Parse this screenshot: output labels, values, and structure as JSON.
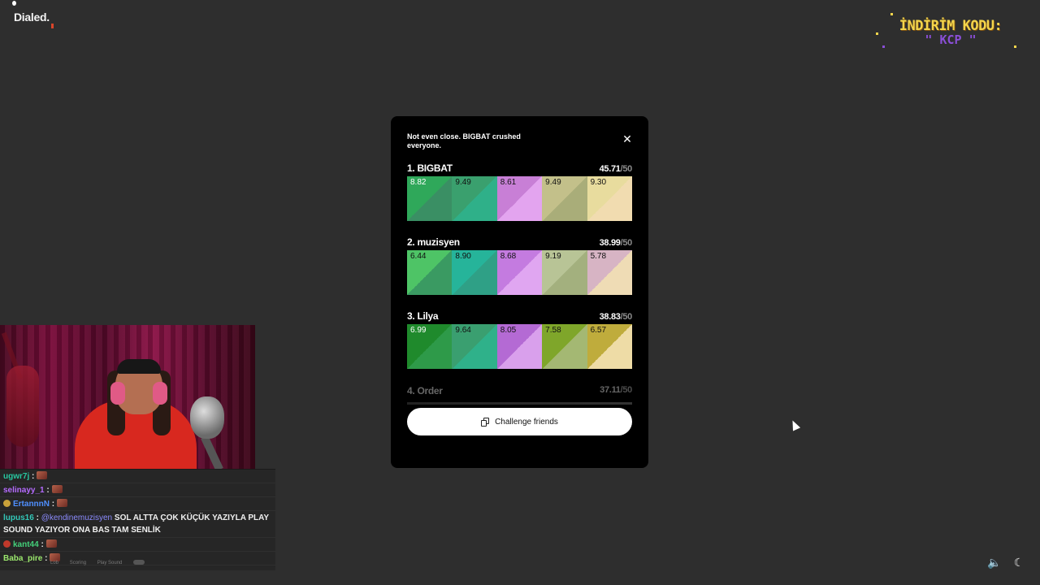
{
  "app": {
    "logo": "Dialed."
  },
  "promo": {
    "line1": "İNDİRİM KODU:",
    "line2": "\" KCP \""
  },
  "modal": {
    "message": "Not even close. BIGBAT crushed everyone.",
    "close_icon": "close-icon",
    "score_max": "/50",
    "players": [
      {
        "rank_name": "1. BIGBAT",
        "score": "45.71",
        "max": "/50",
        "tiles": [
          {
            "value": "8.82",
            "a": "#2fa85a",
            "b": "#3a8f64",
            "light": true
          },
          {
            "value": "9.49",
            "a": "#3aa06e",
            "b": "#2fb089",
            "light": false
          },
          {
            "value": "8.61",
            "a": "#c87fd6",
            "b": "#e3a4ef",
            "light": false
          },
          {
            "value": "9.49",
            "a": "#c3c08a",
            "b": "#a9ad79",
            "light": false
          },
          {
            "value": "9.30",
            "a": "#e8dc9e",
            "b": "#f1dcb0",
            "light": false
          }
        ]
      },
      {
        "rank_name": "2. muzisyen",
        "score": "38.99",
        "max": "/50",
        "tiles": [
          {
            "value": "6.44",
            "a": "#4ec466",
            "b": "#3a9a62",
            "light": false
          },
          {
            "value": "8.90",
            "a": "#26b49a",
            "b": "#2fa086",
            "light": false
          },
          {
            "value": "8.68",
            "a": "#c47be0",
            "b": "#e0a6f1",
            "light": false
          },
          {
            "value": "9.19",
            "a": "#b8c496",
            "b": "#a3b07e",
            "light": false
          },
          {
            "value": "5.78",
            "a": "#d7b4c4",
            "b": "#efdcb5",
            "light": false
          }
        ]
      },
      {
        "rank_name": "3. Lilya",
        "score": "38.83",
        "max": "/50",
        "tiles": [
          {
            "value": "6.99",
            "a": "#1f8a2c",
            "b": "#2e9a49",
            "light": true
          },
          {
            "value": "9.64",
            "a": "#3a9f70",
            "b": "#2fb18a",
            "light": false
          },
          {
            "value": "8.05",
            "a": "#b46ad4",
            "b": "#d9a0ec",
            "light": false
          },
          {
            "value": "7.58",
            "a": "#7fa62a",
            "b": "#a4b873",
            "light": false
          },
          {
            "value": "6.57",
            "a": "#bfac3c",
            "b": "#eedca6",
            "light": false
          }
        ]
      }
    ],
    "faded": {
      "rank_name": "4. Order",
      "score": "37.11",
      "max": "/50"
    },
    "challenge_label": "Challenge friends"
  },
  "chat": [
    {
      "user": "ugwr7j",
      "color": "#27c7a0",
      "sep": ":",
      "msg": "",
      "emote": true,
      "badge": null
    },
    {
      "user": "selinayy_1",
      "color": "#b56bff",
      "sep": ":",
      "msg": "",
      "emote": true,
      "badge": null
    },
    {
      "user": "ErtannnN",
      "color": "#4f8fff",
      "sep": ":",
      "msg": "",
      "emote": true,
      "badge": "#c9a23a"
    },
    {
      "user": "lupus16",
      "color": "#33c7b8",
      "sep": ":",
      "mention": "@kendinemuzisyen",
      "msg": "SOL ALTTA ÇOK KÜÇÜK YAZIYLA PLAY SOUND YAZIYOR ONA BAS TAM SENLİK",
      "emote": false,
      "badge": null
    },
    {
      "user": "kant44",
      "color": "#44d07a",
      "sep": ":",
      "msg": "",
      "emote": true,
      "badge": "#c0392b"
    },
    {
      "user": "Baba_pire",
      "color": "#9be86d",
      "sep": ":",
      "msg": "",
      "emote": true,
      "badge": null
    }
  ],
  "footer_links": [
    "Lob",
    "Scoring",
    "Play Sound"
  ],
  "controls": {
    "volume_icon": "🔈",
    "theme_icon": "☾"
  }
}
